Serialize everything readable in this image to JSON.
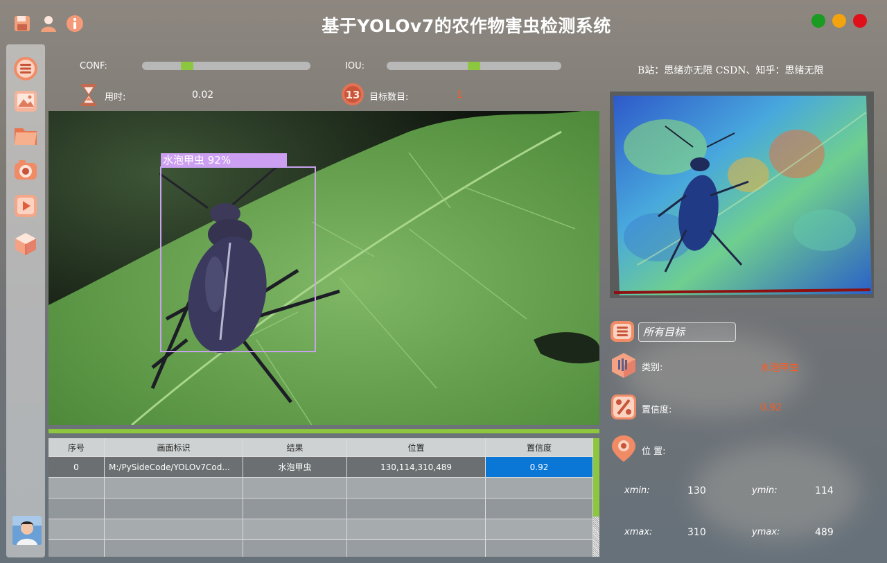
{
  "app": {
    "title": "基于YOLOv7的农作物害虫检测系统",
    "credit": "B站：思绪亦无限  CSDN、知乎：思绪无限"
  },
  "colors": {
    "accent_green": "#8dc63f",
    "value_orange": "#ff5a1f",
    "selected_cell": "#0a76d6"
  },
  "top_icons": [
    "save-icon",
    "user-icon",
    "info-icon"
  ],
  "window_buttons": [
    "maximize-button",
    "minimize-button",
    "close-button"
  ],
  "sidebar": [
    "menu-icon",
    "image-icon",
    "folder-icon",
    "camera-icon",
    "video-play-icon",
    "model-cube-icon"
  ],
  "controls": {
    "conf_label": "CONF:",
    "conf_value": 0.25,
    "iou_label": "IOU:",
    "iou_value": 0.5,
    "time_label": "用时:",
    "time_value": "0.02",
    "count_label": "目标数目:",
    "count_value": "1"
  },
  "detection": {
    "box_label": "水泡甲虫 92%"
  },
  "table": {
    "headers": [
      "序号",
      "画面标识",
      "结果",
      "位置",
      "置信度"
    ],
    "rows": [
      [
        "0",
        "M:/PySideCode/YOLOv7Cod...",
        "水泡甲虫",
        "130,114,310,489",
        "0.92"
      ]
    ]
  },
  "panel": {
    "select_value": "所有目标",
    "category_label": "类别:",
    "category_value": "水泡甲虫",
    "confidence_label": "置信度:",
    "confidence_value": "0.92",
    "position_label": "位 置:",
    "xmin_label": "xmin:",
    "xmin_value": "130",
    "ymin_label": "ymin:",
    "ymin_value": "114",
    "xmax_label": "xmax:",
    "xmax_value": "310",
    "ymax_label": "ymax:",
    "ymax_value": "489"
  }
}
